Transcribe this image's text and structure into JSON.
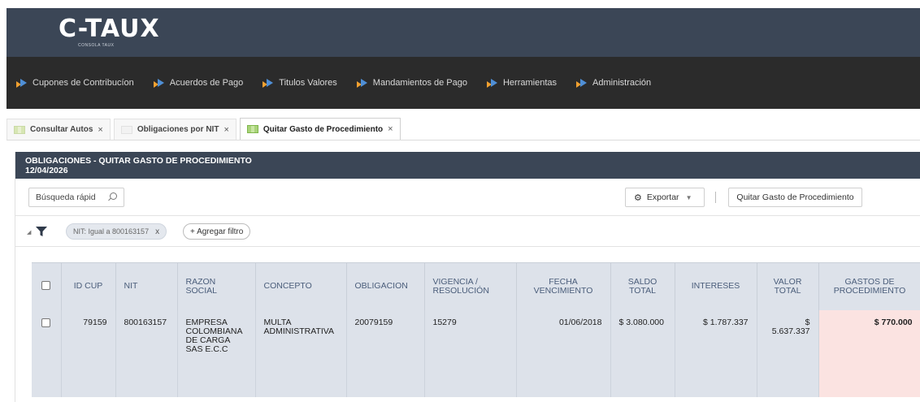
{
  "header": {
    "logo_text": "C-TAUX",
    "logo_sub": "CONSOLA TAUX"
  },
  "nav": {
    "items": [
      {
        "label": "Cupones de Contribucíon"
      },
      {
        "label": "Acuerdos de Pago"
      },
      {
        "label": "Titulos Valores"
      },
      {
        "label": "Mandamientos de Pago"
      },
      {
        "label": "Herramientas"
      },
      {
        "label": "Administración"
      }
    ]
  },
  "tabs": [
    {
      "label": "Consultar Autos",
      "close": "×"
    },
    {
      "label": "Obligaciones por NIT",
      "close": "×"
    },
    {
      "label": "Quitar Gasto de Procedimiento",
      "close": "×",
      "active": true
    }
  ],
  "panel": {
    "title": "OBLIGACIONES - QUITAR GASTO DE PROCEDIMIENTO",
    "date": "12/04/2026"
  },
  "toolbar": {
    "search_placeholder": "Búsqueda rápid",
    "export_label": "Exportar",
    "action_label": "Quitar Gasto de Procedimiento"
  },
  "filters": {
    "chip_label": "NIT: Igual a 800163157",
    "chip_close": "x",
    "add_label": "+ Agregar filtro"
  },
  "table": {
    "columns": [
      "ID CUP",
      "NIT",
      "RAZON SOCIAL",
      "CONCEPTO",
      "OBLIGACION",
      "VIGENCIA / RESOLUCIÓN",
      "FECHA VENCIMIENTO",
      "SALDO TOTAL",
      "INTERESES",
      "VALOR TOTAL",
      "GASTOS DE PROCEDIMIENTO"
    ],
    "rows": [
      {
        "id_cup": "79159",
        "nit": "800163157",
        "razon_social": "EMPRESA COLOMBIANA DE CARGA SAS E.C.C",
        "concepto": "MULTA ADMINISTRATIVA",
        "obligacion": "20079159",
        "vigencia": "15279",
        "fecha_vencimiento": "01/06/2018",
        "saldo_total": "$ 3.080.000",
        "intereses": "$ 1.787.337",
        "valor_total": "$ 5.637.337",
        "gastos": "$ 770.000"
      }
    ]
  },
  "colors": {
    "header_bg": "#3b4656",
    "nav_bg": "#2b2b2b",
    "table_bg": "#dde2ea",
    "highlight": "#fbe3e1"
  }
}
